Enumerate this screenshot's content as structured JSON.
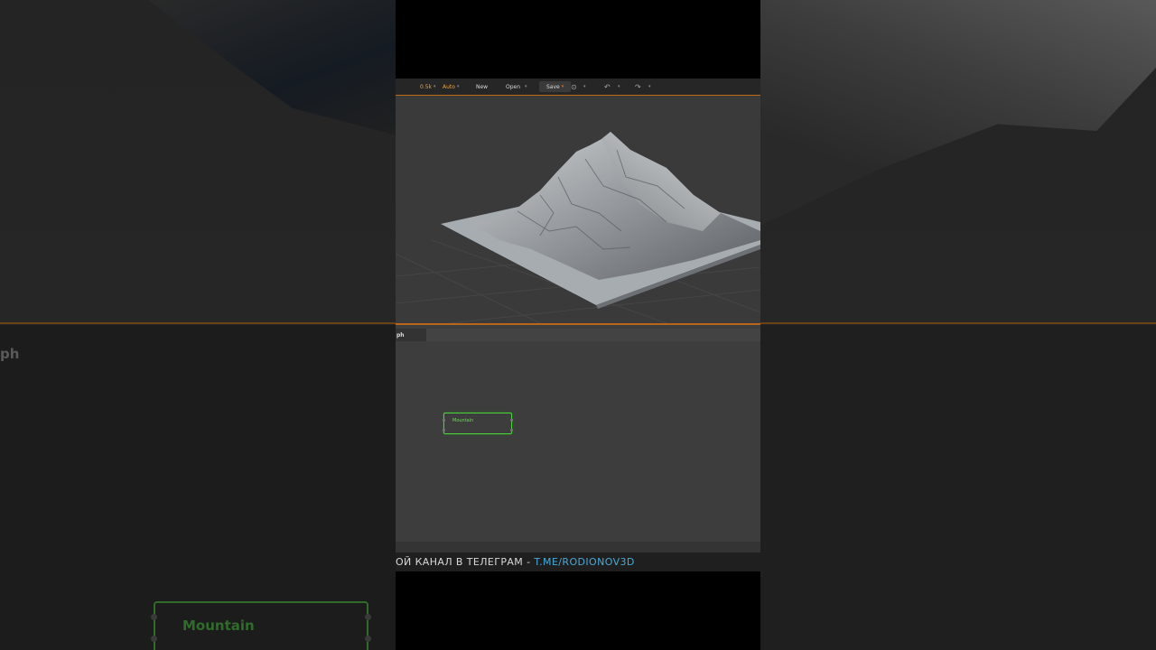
{
  "toolbar": {
    "resolution": "0.5k",
    "mode": "Auto",
    "new_label": "New",
    "open_label": "Open",
    "save_label": "Save"
  },
  "graph": {
    "tab_label": "ph",
    "node_title": "Mountain"
  },
  "backdrop": {
    "graph_label": "ph",
    "node_title": "Mountain"
  },
  "caption": {
    "text": "ОЙ КАНАЛ В ТЕЛЕГРАМ - ",
    "link": "T.ME/RODIONOV3D"
  },
  "colors": {
    "accent": "#c06a16",
    "node_border": "#4cd23c",
    "link": "#4aa9d8"
  },
  "icons": [
    "chevron-down-icon",
    "history-icon",
    "undo-icon",
    "redo-icon"
  ]
}
